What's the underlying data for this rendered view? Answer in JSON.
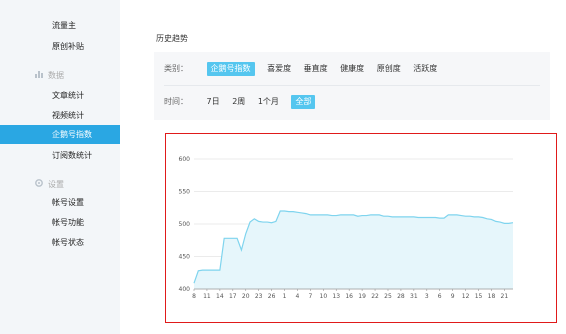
{
  "sidebar": {
    "group1_items": [
      {
        "label": "流量主"
      },
      {
        "label": "原创补贴"
      }
    ],
    "section_data": {
      "icon": "bar-chart-icon",
      "label": "数据"
    },
    "group2_items": [
      {
        "label": "文章统计"
      },
      {
        "label": "视频统计"
      },
      {
        "label": "企鹅号指数",
        "active": true
      },
      {
        "label": "订阅数统计"
      }
    ],
    "section_settings": {
      "icon": "gear-icon",
      "label": "设置"
    },
    "group3_items": [
      {
        "label": "帐号设置"
      },
      {
        "label": "帐号功能"
      },
      {
        "label": "帐号状态"
      }
    ]
  },
  "main": {
    "title": "历史趋势",
    "category_label": "类别：",
    "categories": [
      "企鹅号指数",
      "喜爱度",
      "垂直度",
      "健康度",
      "原创度",
      "活跃度"
    ],
    "category_selected": "企鹅号指数",
    "time_label": "时间：",
    "time_options": [
      "7日",
      "2周",
      "1个月",
      "全部"
    ],
    "time_selected": "全部"
  },
  "colors": {
    "accent": "#2aa7e3",
    "chip": "#55c6ef",
    "line": "#7fd4ee",
    "area": "#e6f6fb",
    "frame": "#e01a1a"
  },
  "chart_data": {
    "type": "area",
    "ylim": [
      400,
      600
    ],
    "yticks": [
      400,
      450,
      500,
      550,
      600
    ],
    "x": [
      "8",
      "9",
      "10",
      "11",
      "12",
      "13",
      "14",
      "15",
      "16",
      "17",
      "18",
      "19",
      "20",
      "21",
      "22",
      "23",
      "24",
      "25",
      "26",
      "27",
      "28",
      "29",
      "30",
      "1",
      "2",
      "3",
      "4",
      "5",
      "6",
      "7",
      "8",
      "9",
      "10",
      "11",
      "12",
      "13",
      "14",
      "15",
      "16",
      "17",
      "18",
      "19",
      "20",
      "21",
      "22",
      "23",
      "24",
      "25",
      "26",
      "27",
      "28",
      "29",
      "30",
      "31",
      "1",
      "2",
      "3",
      "4",
      "5",
      "6",
      "7",
      "8",
      "9",
      "10",
      "11",
      "12",
      "13",
      "14",
      "15",
      "16",
      "17",
      "18",
      "19",
      "20",
      "21"
    ],
    "xtick_labels": [
      "8",
      "11",
      "14",
      "17",
      "20",
      "23",
      "26",
      "1",
      "4",
      "7",
      "10",
      "13",
      "16",
      "19",
      "22",
      "25",
      "28",
      "31",
      "3",
      "6",
      "9",
      "12",
      "15",
      "18",
      "21"
    ],
    "values": [
      409,
      428,
      429,
      429,
      429,
      429,
      429,
      478,
      478,
      478,
      478,
      460,
      485,
      503,
      508,
      504,
      503,
      503,
      502,
      504,
      520,
      520,
      519,
      519,
      518,
      517,
      516,
      514,
      514,
      514,
      514,
      514,
      513,
      513,
      514,
      514,
      514,
      514,
      512,
      513,
      513,
      514,
      514,
      514,
      512,
      512,
      511,
      511,
      511,
      511,
      511,
      511,
      510,
      510,
      510,
      510,
      510,
      509,
      509,
      514,
      514,
      514,
      513,
      512,
      512,
      511,
      511,
      510,
      508,
      507,
      504,
      503,
      501,
      501,
      502
    ]
  }
}
